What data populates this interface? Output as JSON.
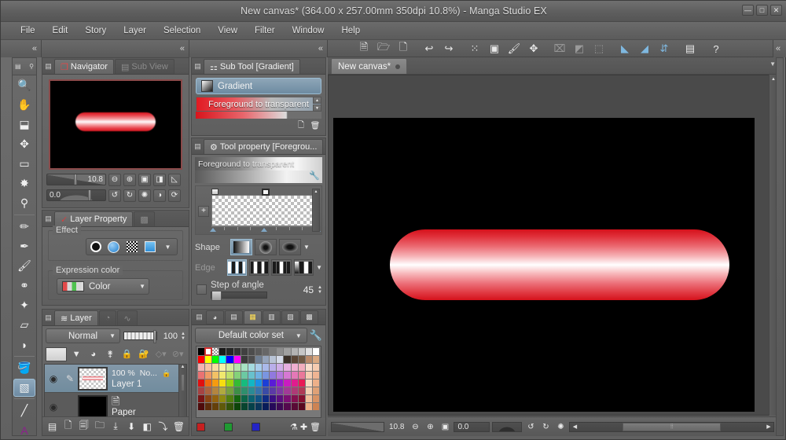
{
  "window": {
    "title": "New canvas* (364.00 x 257.00mm 350dpi 10.8%)  - Manga Studio EX",
    "minimize": "—",
    "maximize": "□",
    "close": "✕"
  },
  "menu": {
    "items": [
      "File",
      "Edit",
      "Story",
      "Layer",
      "Selection",
      "View",
      "Filter",
      "Window",
      "Help"
    ]
  },
  "collapse": {
    "chevron": "«"
  },
  "toolbar": {
    "buttons": [
      {
        "name": "new-file-icon",
        "glyph": "🗎"
      },
      {
        "name": "open-file-icon",
        "glyph": "🗁"
      },
      {
        "name": "save-file-icon",
        "glyph": "🗋"
      },
      {
        "name": "undo-icon",
        "glyph": "↩"
      },
      {
        "name": "redo-icon",
        "glyph": "↪"
      },
      {
        "name": "select-scatter-icon",
        "glyph": "⁙"
      },
      {
        "name": "transform-icon",
        "glyph": "▣"
      },
      {
        "name": "fill-icon",
        "glyph": "🖌"
      },
      {
        "name": "mesh-transform-icon",
        "glyph": "✥"
      },
      {
        "name": "clear-icon",
        "glyph": "⌧"
      },
      {
        "name": "invert-icon",
        "glyph": "◩"
      },
      {
        "name": "deselect-icon",
        "glyph": "⬚"
      },
      {
        "name": "ruler-snap-icon",
        "glyph": "◣"
      },
      {
        "name": "angle-snap-icon",
        "glyph": "◢"
      },
      {
        "name": "symmetry-snap-icon",
        "glyph": "⇵"
      },
      {
        "name": "page-manage-icon",
        "glyph": "▤"
      },
      {
        "name": "help-icon",
        "glyph": "?"
      }
    ]
  },
  "tools": {
    "header_glyph": "▤",
    "items": [
      {
        "name": "zoom-tool",
        "glyph": "🔍",
        "selected": false
      },
      {
        "name": "hand-tool",
        "glyph": "✋",
        "selected": false
      },
      {
        "name": "rotate-tool",
        "glyph": "⬓",
        "selected": false
      },
      {
        "name": "move-tool",
        "glyph": "✥",
        "selected": false
      },
      {
        "name": "marquee-select-tool",
        "glyph": "▭",
        "selected": false
      },
      {
        "name": "magic-wand-tool",
        "glyph": "✸",
        "selected": false
      },
      {
        "name": "eyedropper-tool",
        "glyph": "⚲",
        "selected": false
      },
      {
        "name": "pencil-tool",
        "glyph": "✏",
        "selected": false
      },
      {
        "name": "pen-tool",
        "glyph": "✒",
        "selected": false
      },
      {
        "name": "brush-tool",
        "glyph": "🖌",
        "selected": false
      },
      {
        "name": "airbrush-tool",
        "glyph": "⚭",
        "selected": false
      },
      {
        "name": "decoration-tool",
        "glyph": "✦",
        "selected": false
      },
      {
        "name": "eraser-tool",
        "glyph": "▱",
        "selected": false
      },
      {
        "name": "blend-tool",
        "glyph": "◗",
        "selected": false
      },
      {
        "name": "fill-tool",
        "glyph": "🪣",
        "selected": false
      },
      {
        "name": "gradient-tool",
        "glyph": "▧",
        "selected": true
      },
      {
        "name": "figure-line-tool",
        "glyph": "╱",
        "selected": false
      },
      {
        "name": "text-tool",
        "glyph": "A",
        "selected": false
      }
    ]
  },
  "navigator": {
    "tabs": [
      {
        "name": "tab-navigator",
        "label": "Navigator",
        "active": true
      },
      {
        "name": "tab-sub-view",
        "label": "Sub View",
        "active": false
      }
    ],
    "zoom_value": "10.8",
    "rotation_value": "0.0",
    "buttons": [
      {
        "name": "zoom-out-icon",
        "glyph": "⊖"
      },
      {
        "name": "zoom-in-icon",
        "glyph": "⊕"
      },
      {
        "name": "fit-to-screen-icon",
        "glyph": "▣"
      },
      {
        "name": "flip-horizontal-icon",
        "glyph": "◨"
      },
      {
        "name": "flip-diagonal-icon",
        "glyph": "◺"
      },
      {
        "name": "rotate-left-icon",
        "glyph": "↺"
      },
      {
        "name": "rotate-right-icon",
        "glyph": "↻"
      },
      {
        "name": "reset-rotation-icon",
        "glyph": "✺"
      },
      {
        "name": "flip-view-icon",
        "glyph": "◑"
      },
      {
        "name": "reset-view-icon",
        "glyph": "⟳"
      }
    ]
  },
  "layer_property": {
    "tabs": [
      {
        "name": "tab-layer-property",
        "label": "Layer Property",
        "active": true
      },
      {
        "name": "tab-layer-mask",
        "label": "",
        "active": false
      }
    ],
    "effect_label": "Effect",
    "effects": [
      {
        "name": "effect-tone-icon",
        "kind": "circle-black"
      },
      {
        "name": "effect-border-icon",
        "kind": "circle-blue"
      },
      {
        "name": "effect-texture-icon",
        "kind": "checker"
      },
      {
        "name": "effect-layer-color-icon",
        "kind": "bluesq"
      }
    ],
    "expression_color_label": "Expression color",
    "expression_color_value": "Color",
    "caret": "▼"
  },
  "layer_panel": {
    "tabs": [
      {
        "name": "tab-layer",
        "label": "Layer",
        "active": true
      },
      {
        "name": "tab-animation",
        "label": "",
        "active": false
      },
      {
        "name": "tab-timeline",
        "label": "",
        "active": false
      }
    ],
    "blend_mode": "Normal",
    "opacity": "100",
    "toolbar_icons": [
      {
        "name": "layer-color-swatch",
        "glyph": ""
      },
      {
        "name": "layer-color-caret",
        "glyph": "▼"
      },
      {
        "name": "palette-color-icon",
        "glyph": "◕"
      },
      {
        "name": "ruler-visibility-icon",
        "glyph": "⚵"
      },
      {
        "name": "lock-layer-icon",
        "glyph": "🔒"
      },
      {
        "name": "lock-transparent-icon",
        "glyph": "🔓"
      },
      {
        "name": "mask-enable-icon",
        "glyph": "◇"
      },
      {
        "name": "mask-disable-icon",
        "glyph": "⊘"
      }
    ],
    "rows": [
      {
        "name": "Layer 1",
        "opacity": "100 %",
        "blend": "No...",
        "thumb": "raster",
        "selected": true,
        "eye": "◉",
        "pen": "✎",
        "lock": "🔒"
      },
      {
        "name": "Paper",
        "opacity": "",
        "blend": "",
        "thumb": "black",
        "selected": false,
        "eye": "◉",
        "pen": "",
        "lock": ""
      }
    ],
    "bottom_icons": [
      {
        "name": "layer-palette-icon",
        "glyph": "▤"
      },
      {
        "name": "new-raster-layer-icon",
        "glyph": "🗋"
      },
      {
        "name": "new-vector-layer-icon",
        "glyph": "🗐"
      },
      {
        "name": "new-folder-icon",
        "glyph": "🗀"
      },
      {
        "name": "transfer-down-icon",
        "glyph": "⤓"
      },
      {
        "name": "combine-down-icon",
        "glyph": "⬇"
      },
      {
        "name": "layer-mask-icon",
        "glyph": "◧"
      },
      {
        "name": "clip-to-layer-icon",
        "glyph": "⤵"
      },
      {
        "name": "delete-layer-icon",
        "glyph": "🗑"
      }
    ]
  },
  "sub_tool": {
    "tabs": [
      {
        "name": "tab-sub-tool",
        "label": "Sub Tool [Gradient]",
        "active": true
      }
    ],
    "group_label": "Gradient",
    "selected_item": "Foreground to transparent",
    "footer_icons": [
      {
        "name": "new-sub-tool-icon",
        "glyph": "🗋"
      },
      {
        "name": "delete-sub-tool-icon",
        "glyph": "🗑"
      }
    ],
    "scroll_up": "▲",
    "scroll_down": "▼"
  },
  "tool_property": {
    "tabs": [
      {
        "name": "tab-tool-property",
        "label": "Tool property [Foregrou...",
        "active": true
      }
    ],
    "title": "Foreground to transparent",
    "wrench_icon": "🔧",
    "add_stop_icon": "+",
    "shape_label": "Shape",
    "edge_label": "Edge",
    "step_of_angle_label": "Step of angle",
    "step_of_angle_value": "45",
    "caret": "▼",
    "spin_up": "▲",
    "spin_down": "▼"
  },
  "color_set": {
    "tabs": [
      {
        "name": "tab-color-wheel",
        "glyph": "◕",
        "active": false
      },
      {
        "name": "tab-color-slider",
        "glyph": "▤",
        "active": false
      },
      {
        "name": "tab-color-set",
        "glyph": "▦",
        "active": true
      },
      {
        "name": "tab-intermediate-color",
        "glyph": "▥",
        "active": false
      },
      {
        "name": "tab-approximate-color",
        "glyph": "▨",
        "active": false
      },
      {
        "name": "tab-material",
        "glyph": "▩",
        "active": false
      }
    ],
    "set_name": "Default color set",
    "caret": "▼",
    "wrench_icon": "🔧",
    "footer_swatches": [
      "#c62020",
      "#1f9a32",
      "#2424c6"
    ],
    "footer_icons": [
      {
        "name": "color-picker-icon",
        "glyph": "⚗"
      },
      {
        "name": "add-color-icon",
        "glyph": "✚"
      },
      {
        "name": "delete-color-icon",
        "glyph": "🗑"
      }
    ],
    "swatch_rows": [
      [
        "#000000",
        "#ffffff",
        "#cccccc",
        "#1a1a1a",
        "#262626",
        "#333333",
        "#404040",
        "#4d4d4d",
        "#5a5a5a",
        "#676767",
        "#7a7a7a",
        "#8d8d8d",
        "#a0a0a0",
        "#b3b3b3",
        "#c6c6c6",
        "#e0e0e0",
        "#ffffff"
      ],
      [
        "#ff0000",
        "#ffff00",
        "#00ff00",
        "#00ffff",
        "#0000ff",
        "#ff00ff",
        "#3a3a3a",
        "#4d4d4d",
        "#6f7f93",
        "#95a4bb",
        "#b8c3d6",
        "#d4dae8",
        "#3a3028",
        "#5a4636",
        "#6f5943",
        "#b98a6a",
        "#d9a982"
      ],
      [
        "#f5b2b2",
        "#f7c3a4",
        "#f8dca0",
        "#f6f1a6",
        "#d6eda0",
        "#b4e5ab",
        "#a6e2c3",
        "#a4dbe0",
        "#a8cdec",
        "#aab9ea",
        "#b9aeea",
        "#cfaee8",
        "#e6aee0",
        "#efaed0",
        "#f2aebd",
        "#f9ddcb",
        "#f5cbb0"
      ],
      [
        "#ea7272",
        "#ef9a66",
        "#f2c166",
        "#f0e86e",
        "#bfe06a",
        "#85d179",
        "#6cc9a2",
        "#68c1cd",
        "#6fb1e2",
        "#7a95e0",
        "#9179df",
        "#b579dd",
        "#d678d3",
        "#e478b7",
        "#ea789a",
        "#f6cdb3",
        "#efb493"
      ],
      [
        "#e01010",
        "#ef6a10",
        "#f59b10",
        "#f6dd10",
        "#9bd310",
        "#34bb34",
        "#16bb7e",
        "#12b6c4",
        "#1b8fe6",
        "#1c3fd6",
        "#5a1cd6",
        "#901cd0",
        "#c91cc0",
        "#e01c8e",
        "#e81a55",
        "#f7d9c0",
        "#edb089"
      ],
      [
        "#a64444",
        "#ad6440",
        "#b4853f",
        "#b0a93f",
        "#77a03f",
        "#3d8f46",
        "#2e8f6d",
        "#2a8b95",
        "#3773ab",
        "#3a4ba6",
        "#5c3aa6",
        "#7c3aa3",
        "#a13a97",
        "#ae3a76",
        "#b03a56",
        "#f4cfb2",
        "#dfa176"
      ],
      [
        "#7a1414",
        "#8a4413",
        "#94630f",
        "#8f8a0f",
        "#537f0f",
        "#16660f",
        "#0b6648",
        "#0a6372",
        "#105385",
        "#0f2b85",
        "#3a0f85",
        "#5c0f80",
        "#7c0f74",
        "#85104f",
        "#86102f",
        "#f2c09b",
        "#d89365"
      ],
      [
        "#4e0b0b",
        "#5d2c0b",
        "#64400a",
        "#5f5a0a",
        "#355409",
        "#0d4409",
        "#07442f",
        "#05414a",
        "#0a3659",
        "#091c59",
        "#260959",
        "#3d0955",
        "#54094d",
        "#590a35",
        "#5a0a1f",
        "#eeb287",
        "#cd8353"
      ]
    ]
  },
  "canvas": {
    "tab_label": "New canvas*",
    "tab_dot": "●",
    "scroll_up": "▲",
    "scroll_down": "▼",
    "status": {
      "zoom_value": "10.8",
      "rotation_value": "0.0",
      "icons": [
        {
          "name": "zoom-out-icon",
          "glyph": "⊖"
        },
        {
          "name": "zoom-in-icon",
          "glyph": "⊕"
        },
        {
          "name": "fit-screen-icon",
          "glyph": "▣"
        },
        {
          "name": "rotate-left-icon",
          "glyph": "↺"
        },
        {
          "name": "rotate-right-icon",
          "glyph": "↻"
        },
        {
          "name": "reset-rotation-icon",
          "glyph": "✺"
        }
      ],
      "left_arrow": "◀",
      "right_arrow": "▶",
      "thumb_grip": "⦙⦙"
    }
  }
}
